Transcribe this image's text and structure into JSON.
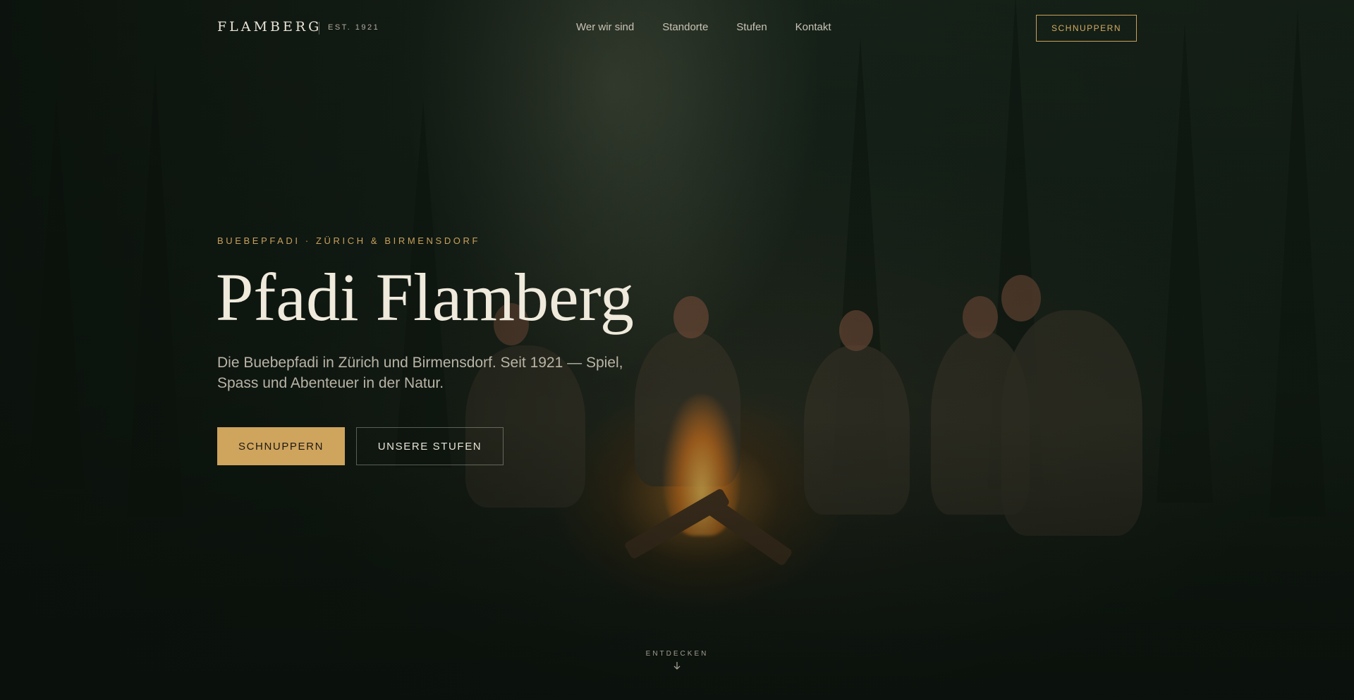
{
  "header": {
    "logo": "FLAMBERG",
    "established": "EST. 1921",
    "menu": [
      {
        "label": "Wer wir sind"
      },
      {
        "label": "Standorte"
      },
      {
        "label": "Stufen"
      },
      {
        "label": "Kontakt"
      }
    ],
    "cta_label": "SCHNUPPERN"
  },
  "hero": {
    "eyebrow": "BUEBEPFADI · ZÜRICH & BIRMENSDORF",
    "title": "Pfadi Flamberg",
    "subtitle": "Die Buebepfadi in Zürich und Birmensdorf. Seit 1921 — Spiel, Spass und Abenteuer in der Natur.",
    "primary_button": "SCHNUPPERN",
    "secondary_button": "UNSERE STUFEN",
    "background_image": "campfire-in-forest-photo"
  },
  "scroll_hint": {
    "label": "ENTDECKEN",
    "icon": "arrow-down-icon"
  },
  "colors": {
    "accent": "#cfa45d",
    "background": "#16231a",
    "text_light": "#efeadc"
  }
}
